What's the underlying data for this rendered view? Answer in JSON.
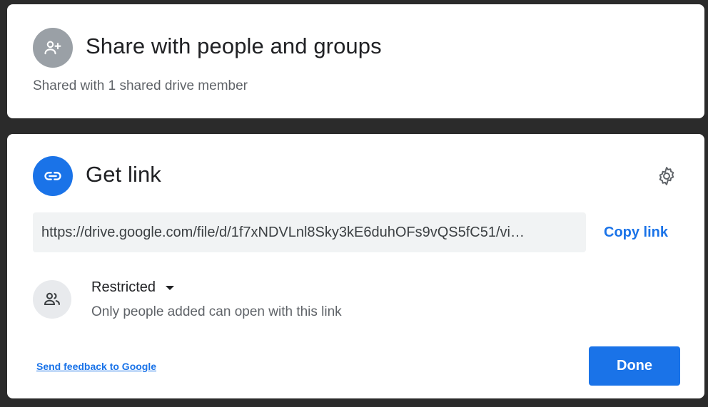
{
  "share": {
    "title": "Share with people and groups",
    "subtitle": "Shared with 1 shared drive member",
    "icon": "person-add-icon",
    "icon_bg": "#9aa0a6"
  },
  "get_link": {
    "title": "Get link",
    "icon": "link-icon",
    "icon_bg": "#1a73e8",
    "settings_icon": "gear-icon",
    "url": "https://drive.google.com/file/d/1f7xNDVLnl8Sky3kE6duhOFs9vQS5fC51/vi…",
    "copy_label": "Copy link",
    "access": {
      "icon": "people-icon",
      "selected": "Restricted",
      "description": "Only people added can open with this link"
    }
  },
  "footer": {
    "feedback_label": "Send feedback to Google",
    "done_label": "Done"
  },
  "colors": {
    "accent": "#1a73e8",
    "backdrop": "#2b2b2b"
  }
}
